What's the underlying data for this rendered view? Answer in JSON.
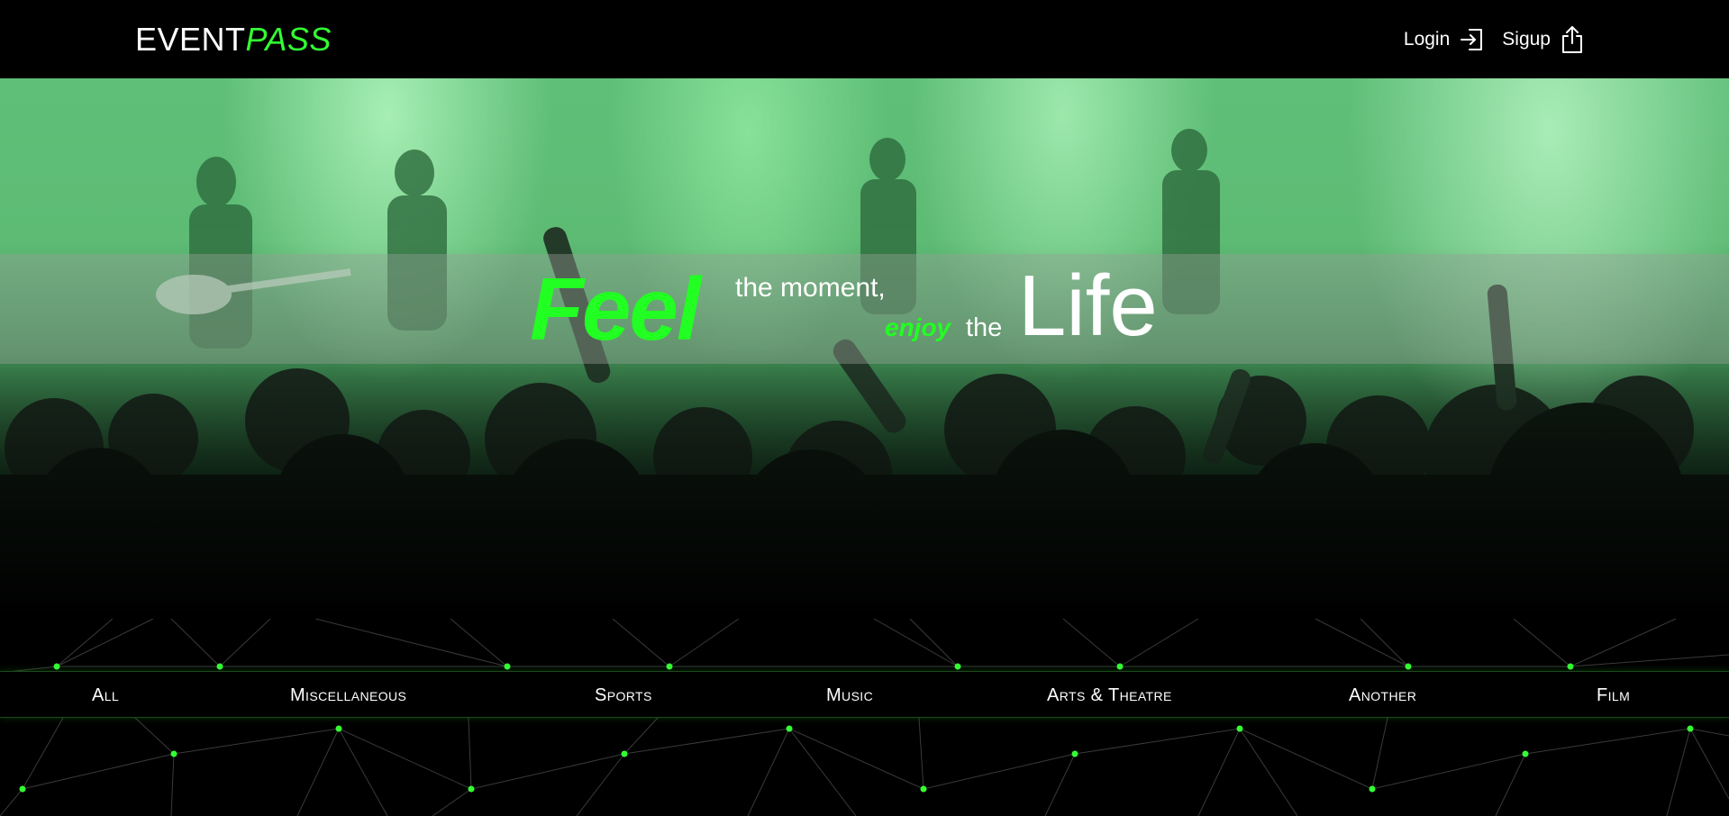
{
  "header": {
    "logo_part1": "EVENT",
    "logo_part2": "PASS",
    "login_label": "Login",
    "signup_label": "Sigup",
    "login_icon": "login-arrow-icon",
    "signup_icon": "share-upload-icon"
  },
  "hero": {
    "feel": "Feel",
    "the_moment": "the moment,",
    "enjoy": "enjoy",
    "the": "the",
    "life": "Life"
  },
  "categories": [
    {
      "label": "All"
    },
    {
      "label": "Miscellaneous"
    },
    {
      "label": "Sports"
    },
    {
      "label": "Music"
    },
    {
      "label": "Arts & Theatre"
    },
    {
      "label": "Another"
    },
    {
      "label": "Film"
    }
  ],
  "colors": {
    "accent": "#22ff22",
    "background": "#000000",
    "text": "#ffffff"
  }
}
